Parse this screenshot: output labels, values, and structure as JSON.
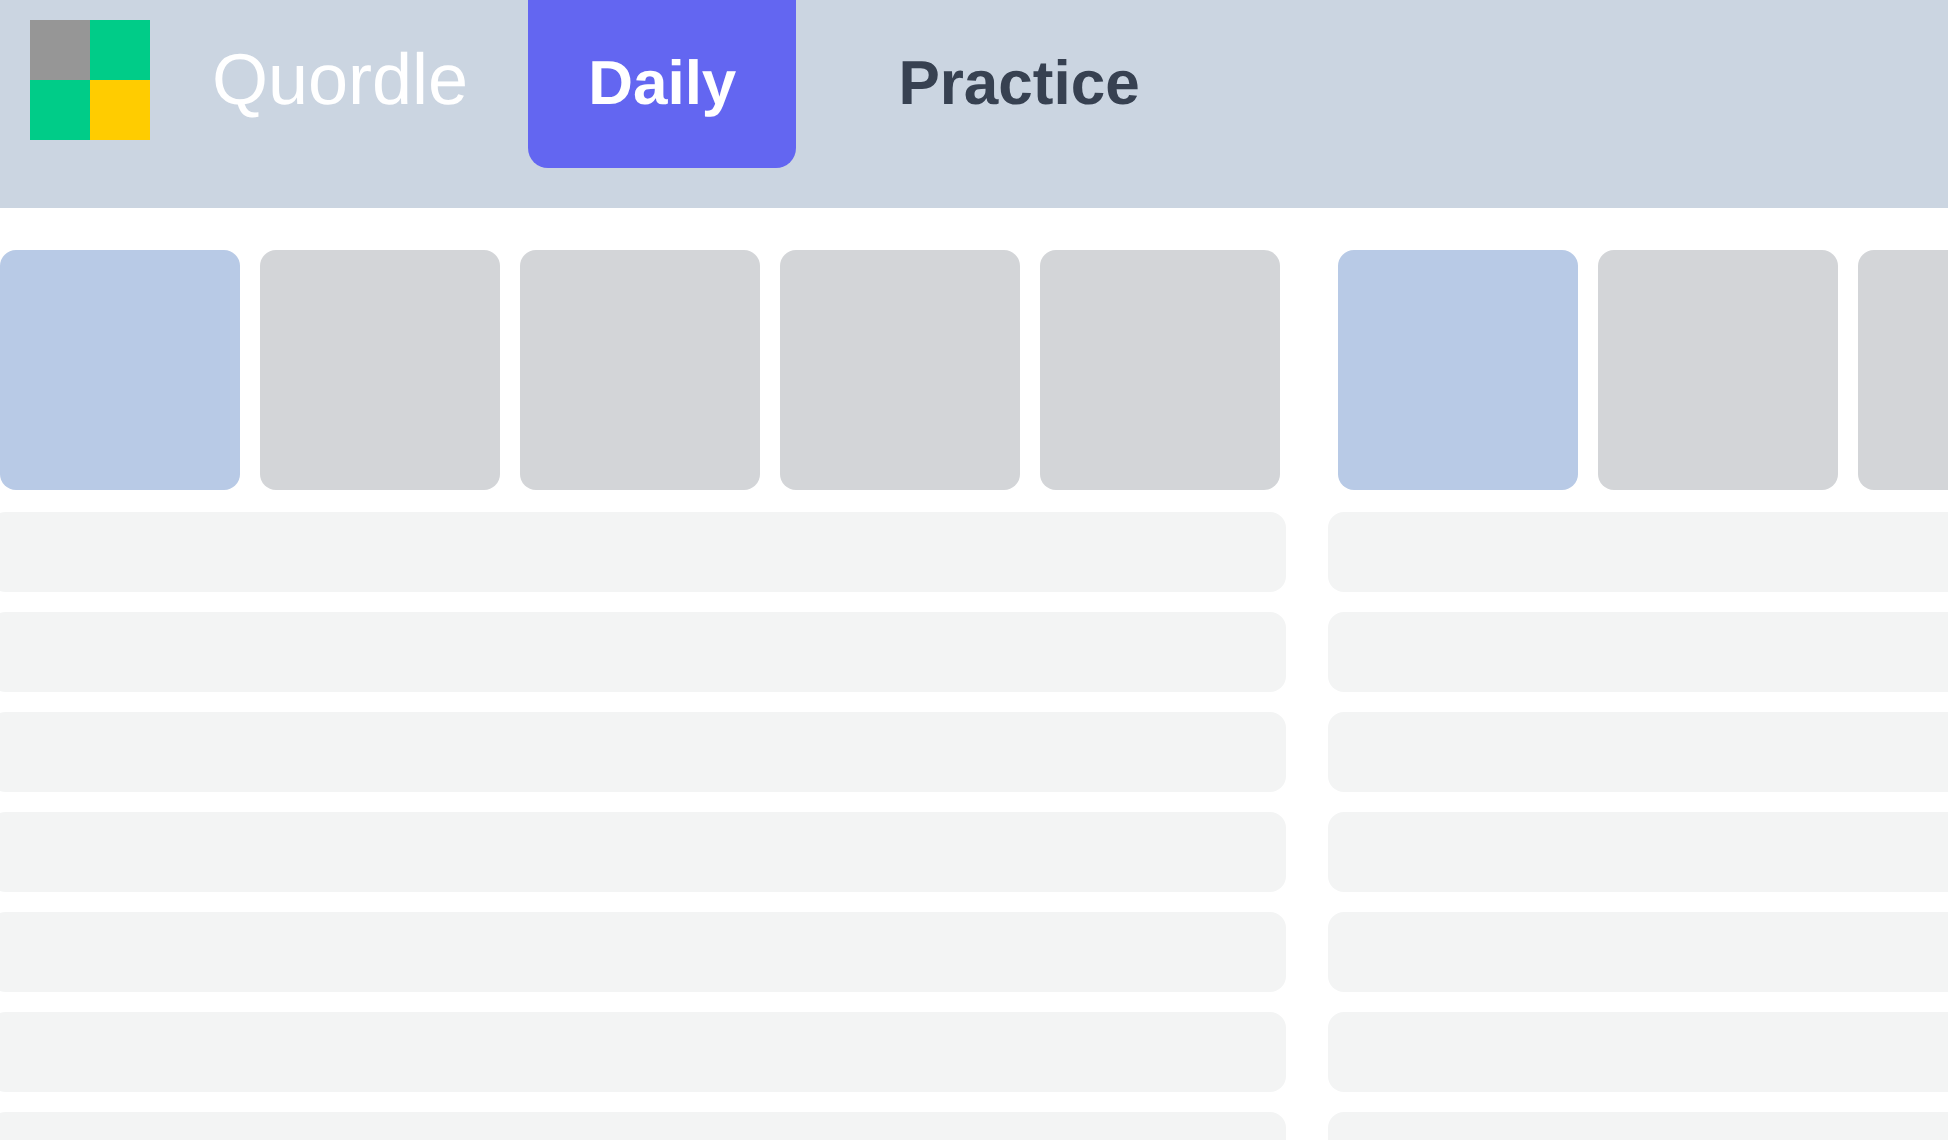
{
  "header": {
    "title": "Quordle",
    "tabs": [
      {
        "label": "Daily",
        "selected": true
      },
      {
        "label": "Practice",
        "selected": false
      }
    ]
  },
  "boards": [
    {
      "tiles": [
        {
          "highlighted": true
        },
        {
          "highlighted": false
        },
        {
          "highlighted": false
        },
        {
          "highlighted": false
        },
        {
          "highlighted": false
        }
      ],
      "rows": [
        {
          "kind": "blank"
        },
        {
          "kind": "blank"
        },
        {
          "kind": "blank"
        },
        {
          "kind": "blank"
        },
        {
          "kind": "blank"
        },
        {
          "kind": "blank"
        },
        {
          "kind": "blank"
        }
      ]
    },
    {
      "tiles": [
        {
          "highlighted": true
        },
        {
          "highlighted": false
        },
        {
          "highlighted": false
        }
      ],
      "rows": [
        {
          "kind": "blank"
        },
        {
          "kind": "blank"
        },
        {
          "kind": "blank"
        },
        {
          "kind": "blank"
        },
        {
          "kind": "blank"
        },
        {
          "kind": "blank"
        },
        {
          "kind": "blank"
        }
      ]
    }
  ]
}
